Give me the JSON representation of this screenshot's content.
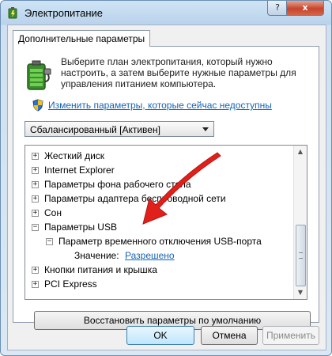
{
  "window": {
    "title": "Электропитание",
    "help_button": "?",
    "close_button": "x"
  },
  "tab": {
    "label": "Дополнительные параметры"
  },
  "description": "Выберите план электропитания, который нужно настроить, а затем выберите нужные параметры для управления питанием компьютера.",
  "change_link": "Изменить параметры, которые сейчас недоступны",
  "plan_select": {
    "value": "Сбалансированный [Активен]"
  },
  "tree": {
    "items": [
      {
        "expander": "+",
        "label": "Жесткий диск"
      },
      {
        "expander": "+",
        "label": "Internet Explorer"
      },
      {
        "expander": "+",
        "label": "Параметры фона рабочего стола"
      },
      {
        "expander": "+",
        "label": "Параметры адаптера беспроводной сети"
      },
      {
        "expander": "+",
        "label": "Сон"
      },
      {
        "expander": "−",
        "label": "Параметры USB"
      },
      {
        "expander": "−",
        "label": "Параметр временного отключения USB-порта"
      },
      {
        "label": "Значение:",
        "value": "Разрешено"
      },
      {
        "expander": "+",
        "label": "Кнопки питания и крышка"
      },
      {
        "expander": "+",
        "label": "PCI Express"
      }
    ]
  },
  "restore_button": "Восстановить параметры по умолчанию",
  "buttons": {
    "ok": "OK",
    "cancel": "Отмена",
    "apply": "Применить"
  },
  "colors": {
    "link": "#1464b4",
    "arrow": "#e0201a",
    "title_bar": "#b9d3ec"
  }
}
